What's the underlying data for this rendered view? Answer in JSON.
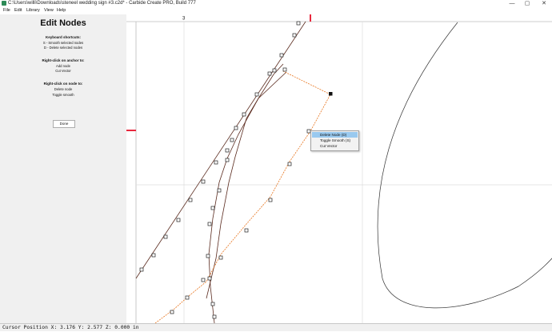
{
  "window": {
    "title": "C:\\Users\\willi\\Downloads\\steneel wedding sign #3.c2d* - Carbide Create PRO, Build 777",
    "controls": {
      "minimize": "—",
      "maximize": "▢",
      "close": "✕"
    }
  },
  "menu": {
    "items": [
      "File",
      "Edit",
      "Library",
      "View",
      "Help"
    ]
  },
  "panel": {
    "title": "Edit Nodes",
    "shortcuts_heading": "Keyboard shortcuts:",
    "shortcuts": [
      "S - Smooth selected nodes",
      "D - Delete selected nodes"
    ],
    "anchor_heading": "Right-click on anchor to:",
    "anchor_actions": [
      "Add node",
      "Cut Vector"
    ],
    "node_heading": "Right-click on node to:",
    "node_actions": [
      "Delete node",
      "Toggle smooth"
    ],
    "done_label": "Done"
  },
  "canvas": {
    "ruler_label": "3"
  },
  "context_menu": {
    "items": [
      "Delete Node (D)",
      "Toggle Smooth (S)",
      "Cut Vector"
    ],
    "selected_index": 0
  },
  "status": {
    "text": "Cursor Position X: 3.176 Y: 2.577 Z: 0.000 in"
  },
  "colors": {
    "path": "#5a2a1e",
    "selected_path": "#e87722",
    "ruler_marker": "#e8273d",
    "grid": "#dddddd",
    "menu_highlight": "#99c9ef"
  }
}
